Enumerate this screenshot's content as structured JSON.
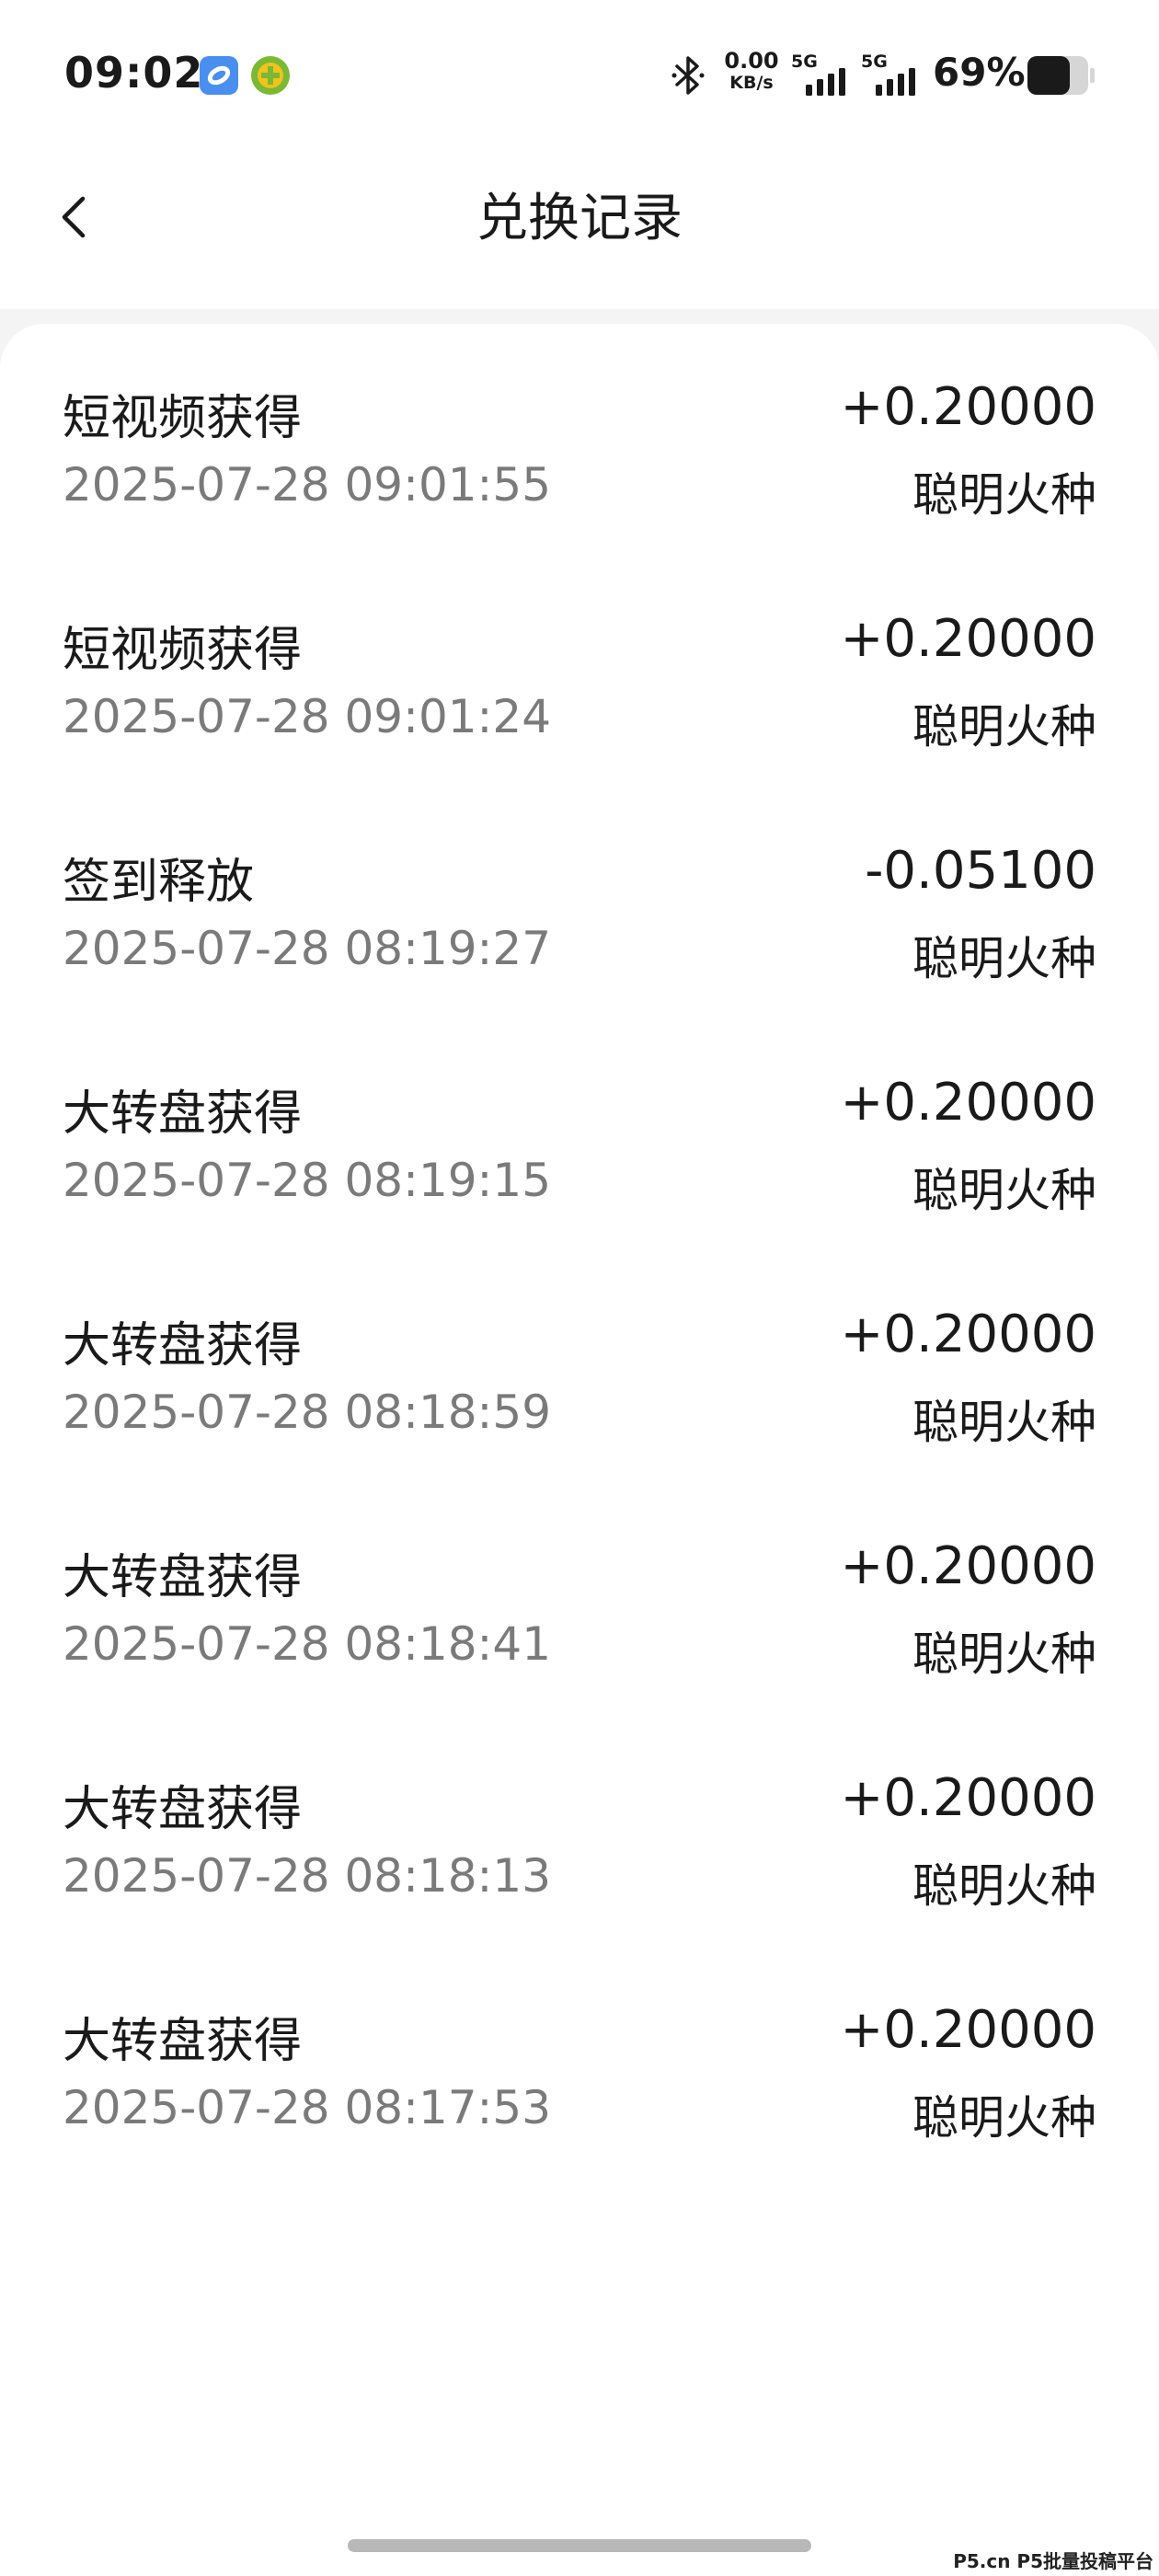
{
  "status_bar": {
    "time": "09:02",
    "net_speed_value": "0.00",
    "net_speed_unit": "KB/s",
    "signal_1_label": "5G",
    "signal_2_label": "5G",
    "battery_percent": "69%",
    "battery_level": 0.69,
    "icons": [
      "app-badge-icon",
      "app-badge-icon",
      "bluetooth-icon",
      "signal-icon",
      "signal-icon",
      "battery-icon"
    ]
  },
  "nav": {
    "title": "兑换记录",
    "back_icon": "chevron-left-icon"
  },
  "records": [
    {
      "title": "短视频获得",
      "time": "2025-07-28 09:01:55",
      "amount": "+0.20000",
      "unit": "聪明火种"
    },
    {
      "title": "短视频获得",
      "time": "2025-07-28 09:01:24",
      "amount": "+0.20000",
      "unit": "聪明火种"
    },
    {
      "title": "签到释放",
      "time": "2025-07-28 08:19:27",
      "amount": "-0.05100",
      "unit": "聪明火种"
    },
    {
      "title": "大转盘获得",
      "time": "2025-07-28 08:19:15",
      "amount": "+0.20000",
      "unit": "聪明火种"
    },
    {
      "title": "大转盘获得",
      "time": "2025-07-28 08:18:59",
      "amount": "+0.20000",
      "unit": "聪明火种"
    },
    {
      "title": "大转盘获得",
      "time": "2025-07-28 08:18:41",
      "amount": "+0.20000",
      "unit": "聪明火种"
    },
    {
      "title": "大转盘获得",
      "time": "2025-07-28 08:18:13",
      "amount": "+0.20000",
      "unit": "聪明火种"
    },
    {
      "title": "大转盘获得",
      "time": "2025-07-28 08:17:53",
      "amount": "+0.20000",
      "unit": "聪明火种"
    }
  ],
  "watermark": "P5.cn P5批量投稿平台",
  "colors": {
    "background": "#f4f4f4",
    "card": "#ffffff",
    "primary_text": "#1a1a1a",
    "secondary_text": "#7a7a7a"
  }
}
